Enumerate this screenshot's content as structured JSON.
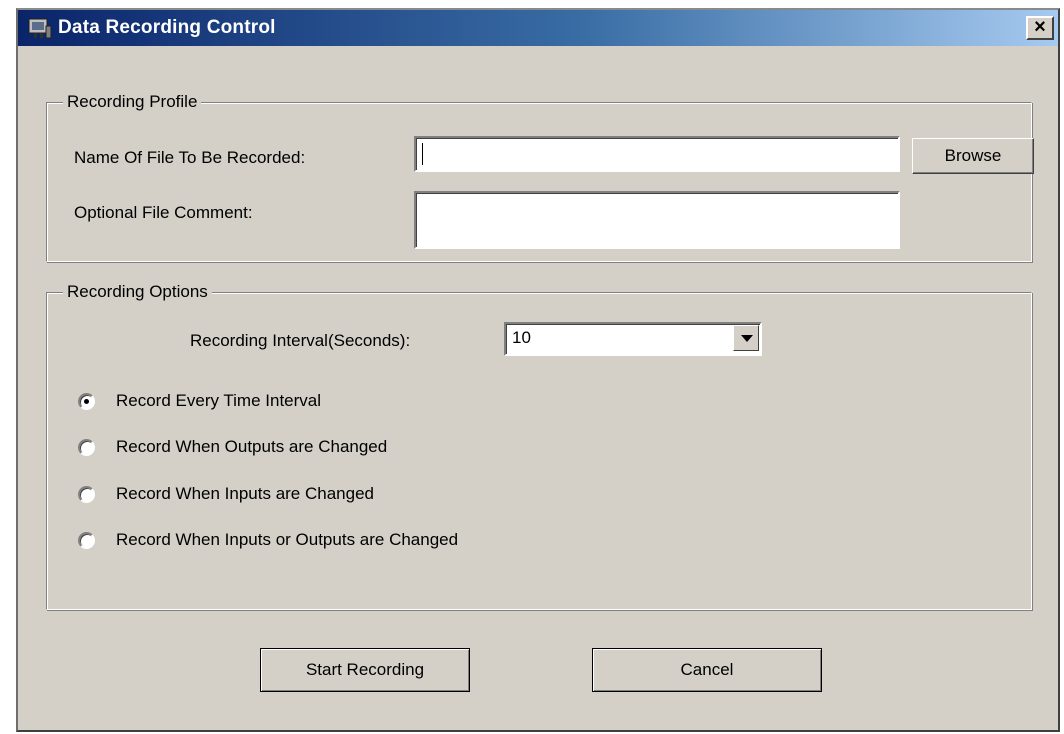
{
  "window": {
    "title": "Data Recording Control",
    "close_label": "×"
  },
  "recording_profile": {
    "group_label": "Recording Profile",
    "file_name_label": "Name Of File To Be Recorded:",
    "file_name_value": "",
    "browse_label": "Browse",
    "comment_label": "Optional File Comment:",
    "comment_value": ""
  },
  "recording_options": {
    "group_label": "Recording Options",
    "interval_label": "Recording Interval(Seconds):",
    "interval_value": "10",
    "radio_options": [
      {
        "label": "Record Every Time Interval",
        "checked": true
      },
      {
        "label": "Record When Outputs are Changed",
        "checked": false
      },
      {
        "label": "Record When Inputs are Changed",
        "checked": false
      },
      {
        "label": "Record When Inputs or Outputs are Changed",
        "checked": false
      }
    ]
  },
  "actions": {
    "start_label": "Start Recording",
    "cancel_label": "Cancel"
  },
  "icons": {
    "title_icon": "recorder-app-icon",
    "close_icon": "close-icon",
    "dropdown_icon": "chevron-down-icon"
  }
}
